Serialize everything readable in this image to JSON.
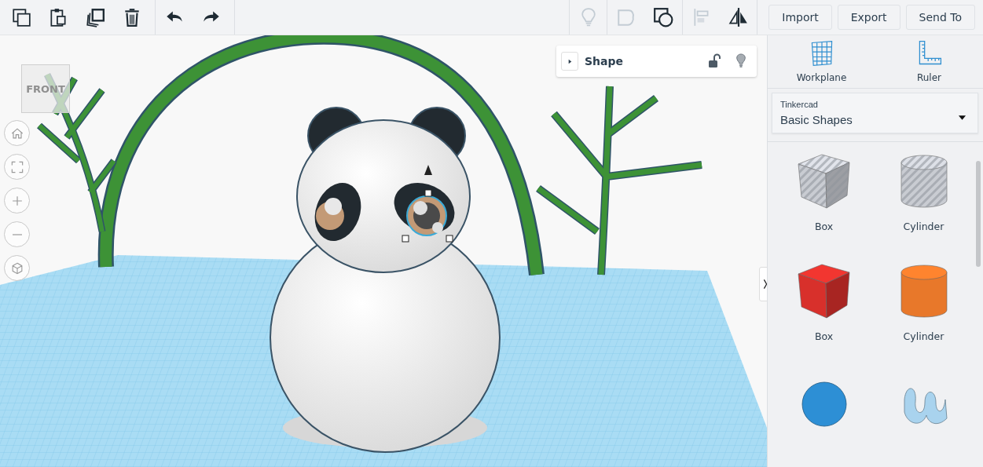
{
  "toolbar": {
    "edit_tools": [
      {
        "kind": "copy"
      },
      {
        "kind": "paste"
      },
      {
        "kind": "duplicate"
      },
      {
        "kind": "delete"
      }
    ],
    "history_tools": [
      {
        "kind": "undo"
      },
      {
        "kind": "redo"
      }
    ],
    "view_tools": [
      {
        "kind": "bulb",
        "disabled": true
      },
      {
        "kind": "group",
        "disabled": true
      },
      {
        "kind": "hole",
        "disabled": false
      },
      {
        "kind": "align",
        "disabled": true
      },
      {
        "kind": "mirror",
        "disabled": false
      }
    ],
    "actions": [
      "Import",
      "Export",
      "Send To"
    ]
  },
  "view_cube": {
    "label": "FRONT"
  },
  "view_controls": [
    {
      "kind": "home"
    },
    {
      "kind": "fit"
    },
    {
      "kind": "zoom-in"
    },
    {
      "kind": "zoom-out"
    },
    {
      "kind": "perspective"
    }
  ],
  "shape_panel": {
    "title": "Shape",
    "expanded": false,
    "locked": false
  },
  "sidebar": {
    "tools": [
      {
        "kind": "workplane",
        "label": "Workplane"
      },
      {
        "kind": "ruler",
        "label": "Ruler"
      }
    ],
    "library": {
      "caption": "Tinkercad",
      "value": "Basic Shapes"
    },
    "collapsed": false,
    "shapes": [
      {
        "kind": "box",
        "hole": true,
        "color": "#c9ccd2",
        "label": "Box"
      },
      {
        "kind": "cylinder",
        "hole": true,
        "color": "#c9ccd2",
        "label": "Cylinder"
      },
      {
        "kind": "box",
        "hole": false,
        "color": "#d8302b",
        "label": "Box"
      },
      {
        "kind": "cylinder",
        "hole": false,
        "color": "#e8782a",
        "label": "Cylinder"
      },
      {
        "kind": "sphere",
        "color": "#2d8fd5"
      },
      {
        "kind": "scribble",
        "color": "#a9d3ee"
      }
    ]
  }
}
